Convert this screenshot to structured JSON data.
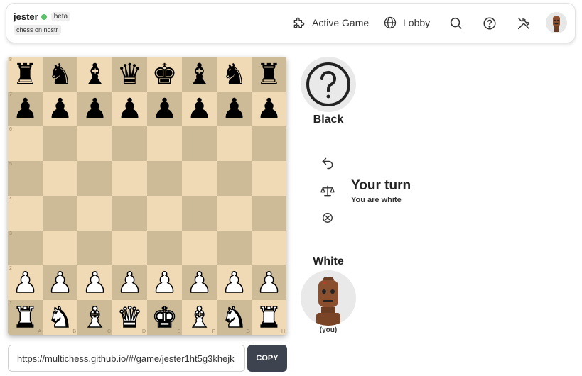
{
  "header": {
    "brand": "jester",
    "badge": "beta",
    "tagline": "chess on nostr",
    "nav": {
      "active_game": "Active Game",
      "lobby": "Lobby"
    },
    "icons": [
      "puzzle-icon",
      "globe-icon",
      "search-icon",
      "help-icon",
      "tools-icon"
    ],
    "status_color": "#5ec26a"
  },
  "board": {
    "light_color": "#f0d9b5",
    "dark_color": "#cdbb98",
    "ranks": [
      "8",
      "7",
      "6",
      "5",
      "4",
      "3",
      "2",
      "1"
    ],
    "files": [
      "A",
      "B",
      "C",
      "D",
      "E",
      "F",
      "G",
      "H"
    ],
    "position": [
      [
        "bR",
        "bN",
        "bB",
        "bQ",
        "bK",
        "bB",
        "bN",
        "bR"
      ],
      [
        "bP",
        "bP",
        "bP",
        "bP",
        "bP",
        "bP",
        "bP",
        "bP"
      ],
      [
        "",
        "",
        "",
        "",
        "",
        "",
        "",
        ""
      ],
      [
        "",
        "",
        "",
        "",
        "",
        "",
        "",
        ""
      ],
      [
        "",
        "",
        "",
        "",
        "",
        "",
        "",
        ""
      ],
      [
        "",
        "",
        "",
        "",
        "",
        "",
        "",
        ""
      ],
      [
        "wP",
        "wP",
        "wP",
        "wP",
        "wP",
        "wP",
        "wP",
        "wP"
      ],
      [
        "wR",
        "wN",
        "wB",
        "wQ",
        "wK",
        "wB",
        "wN",
        "wR"
      ]
    ]
  },
  "share": {
    "url": "https://multichess.github.io/#/game/jester1ht5g3khejk",
    "copy_label": "COPY"
  },
  "players": {
    "black": {
      "name": "Black",
      "icon": "question-icon"
    },
    "white": {
      "name": "White",
      "you_label": "(you)",
      "icon": "robot-avatar"
    }
  },
  "turn": {
    "title": "Your turn",
    "subtitle": "You are white"
  },
  "actions": [
    "undo-icon",
    "scale-icon",
    "resign-icon"
  ]
}
